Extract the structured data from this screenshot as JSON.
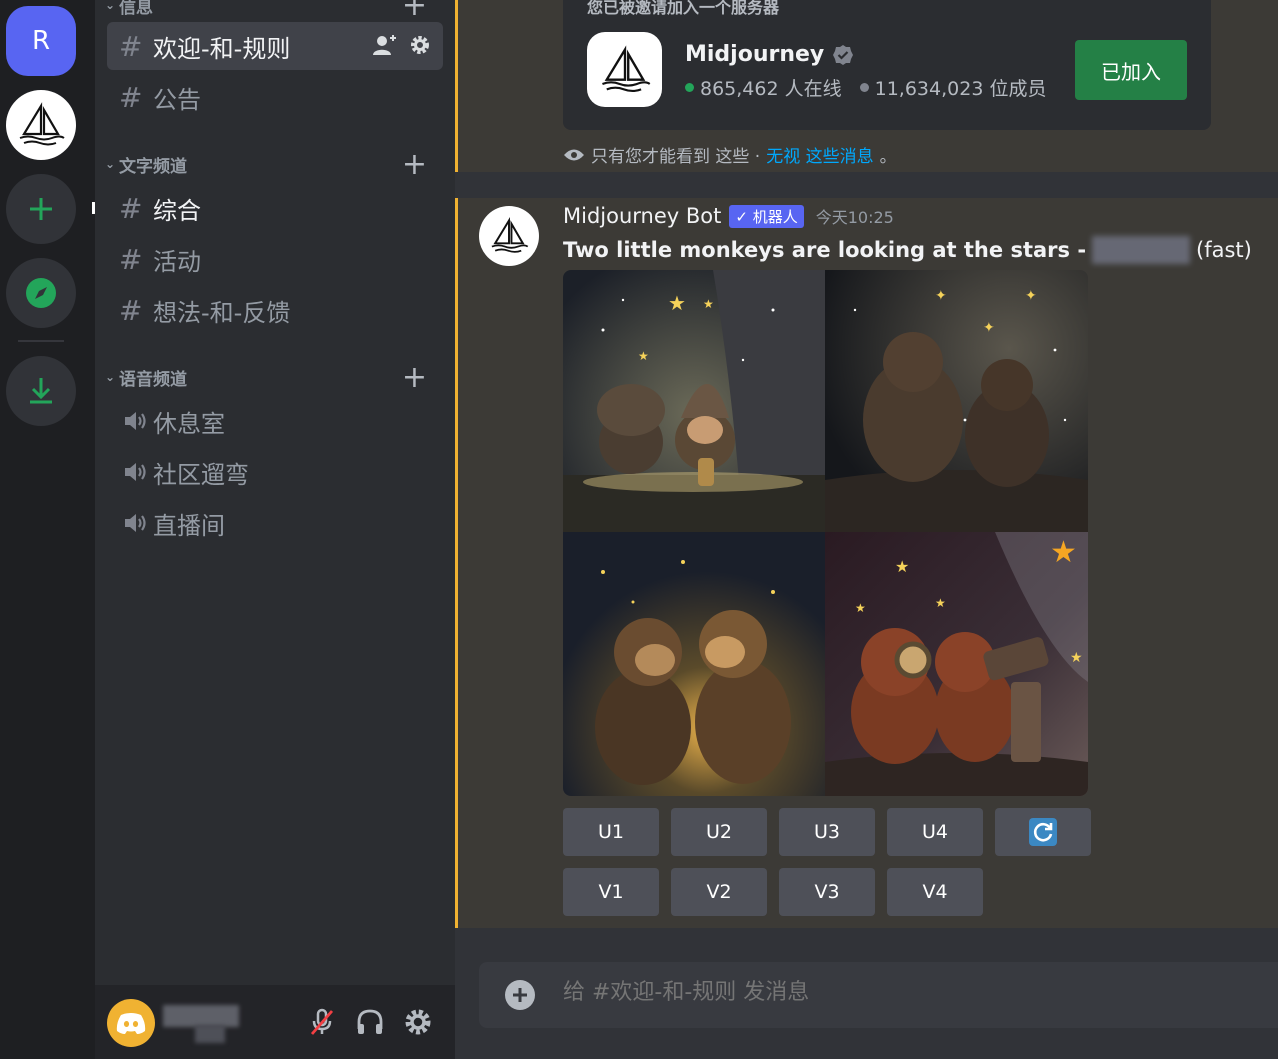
{
  "rail": {
    "home_letter": "R"
  },
  "sidebar": {
    "top_category": "信息",
    "info_channels": [
      {
        "name": "欢迎-和-规则"
      },
      {
        "name": "公告"
      }
    ],
    "text_category": "文字频道",
    "text_channels": [
      {
        "name": "综合"
      },
      {
        "name": "活动"
      },
      {
        "name": "想法-和-反馈"
      }
    ],
    "voice_category": "语音频道",
    "voice_channels": [
      {
        "name": "休息室"
      },
      {
        "name": "社区遛弯"
      },
      {
        "name": "直播间"
      }
    ]
  },
  "invite": {
    "header": "您已被邀请加入一个服务器",
    "server_name": "Midjourney",
    "online": "865,462 人在线",
    "members": "11,634,023 位成员",
    "join_label": "已加入",
    "online_color": "#23a55a",
    "members_color": "#80848e"
  },
  "ephemeral": {
    "text": "只有您才能看到 这些 · ",
    "link": "无视 这些消息",
    "end": "。"
  },
  "message": {
    "author": "Midjourney Bot",
    "tag": "✓ 机器人",
    "time": "今天10:25",
    "prompt": "Two little monkeys are looking at the stars - ",
    "suffix": "(fast)"
  },
  "actions": {
    "row1": [
      "U1",
      "U2",
      "U3",
      "U4"
    ],
    "row2": [
      "V1",
      "V2",
      "V3",
      "V4"
    ],
    "reroll_icon": "refresh-icon"
  },
  "composer": {
    "placeholder": "给 #欢迎-和-规则 发消息"
  },
  "colors": {
    "accent": "#5865f2",
    "highlight_border": "#f0b232",
    "join_green": "#248046"
  }
}
